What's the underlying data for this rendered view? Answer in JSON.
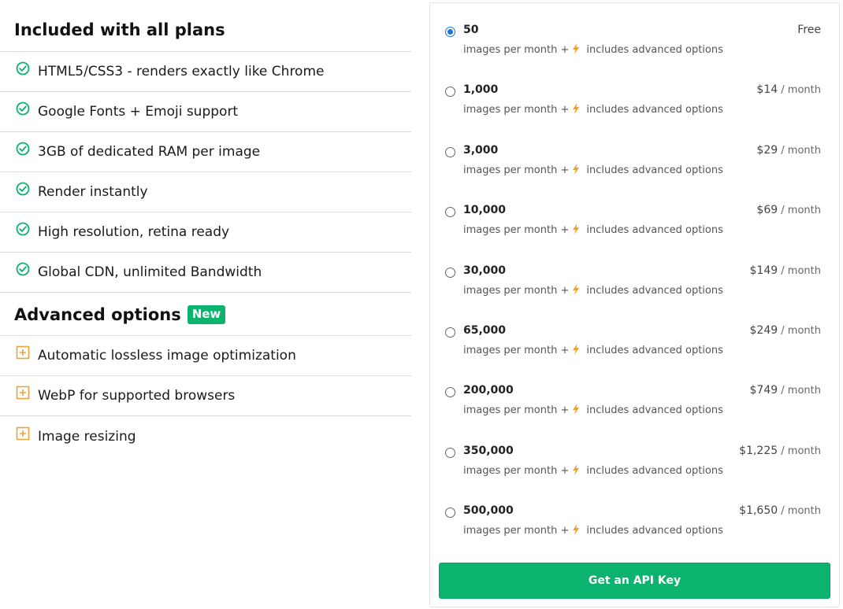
{
  "included": {
    "title": "Included with all plans",
    "items": [
      {
        "label": "HTML5/CSS3 - renders exactly like Chrome"
      },
      {
        "label": "Google Fonts + Emoji support"
      },
      {
        "label": "3GB of dedicated RAM per image"
      },
      {
        "label": "Render instantly"
      },
      {
        "label": "High resolution, retina ready"
      },
      {
        "label": "Global CDN, unlimited Bandwidth"
      }
    ]
  },
  "advanced": {
    "title": "Advanced options",
    "badge": "New",
    "items": [
      {
        "label": "Automatic lossless image optimization"
      },
      {
        "label": "WebP for supported browsers"
      },
      {
        "label": "Image resizing"
      }
    ]
  },
  "plans": {
    "desc_prefix": "images per month +",
    "desc_suffix": "includes advanced options",
    "per_month": "/ month",
    "selected": "50",
    "items": [
      {
        "count": "50",
        "price": "Free",
        "checked": true
      },
      {
        "count": "1,000",
        "price": "$14"
      },
      {
        "count": "3,000",
        "price": "$29"
      },
      {
        "count": "10,000",
        "price": "$69"
      },
      {
        "count": "30,000",
        "price": "$149"
      },
      {
        "count": "65,000",
        "price": "$249"
      },
      {
        "count": "200,000",
        "price": "$749"
      },
      {
        "count": "350,000",
        "price": "$1,225"
      },
      {
        "count": "500,000",
        "price": "$1,650"
      }
    ]
  },
  "cta": {
    "label": "Get an API Key"
  },
  "colors": {
    "accent": "#0bb36f",
    "check": "#0bb36f",
    "plus": "#e8a33a",
    "bolt": "#f0a030",
    "radio": "#1a73e8"
  }
}
